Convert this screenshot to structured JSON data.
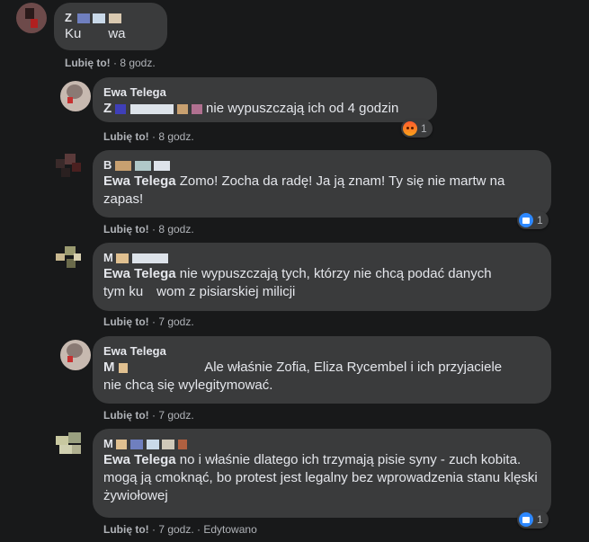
{
  "comments": [
    {
      "name": "Z",
      "text": "Ku  wa",
      "like": "Lubię to!",
      "time": "8 godz."
    },
    {
      "name": "Ewa Telega",
      "mention": "Z",
      "text": "nie wypuszczają ich od 4 godzin",
      "like": "Lubię to!",
      "time": "8 godz.",
      "reaction_count": "1",
      "reaction": "angry-icon"
    },
    {
      "name": "B",
      "mention": "Ewa Telega",
      "text": "Zomo! Zocha da radę! Ja ją znam! Ty się nie martw na zapas!",
      "like": "Lubię to!",
      "time": "8 godz.",
      "reaction_count": "1",
      "reaction": "like-icon"
    },
    {
      "name": "M",
      "mention": "Ewa Telega",
      "text_a": "nie wypuszczają tych, którzy nie chcą podać danych",
      "text_b": "tym ku wom z pisiarskiej milicji",
      "like": "Lubię to!",
      "time": "7 godz."
    },
    {
      "name": "Ewa Telega",
      "mention": "M",
      "text_a": "Ale właśnie Zofia, Eliza Rycembel i ich przyjaciele",
      "text_b": "nie chcą się wylegitymować.",
      "like": "Lubię to!",
      "time": "7 godz."
    },
    {
      "name": "M",
      "mention": "Ewa Telega",
      "text": "no i właśnie dlatego ich trzymają pisie syny - zuch kobita. mogą ją cmoknąć, bo protest jest legalny bez wprowadzenia stanu klęski żywiołowej",
      "like": "Lubię to!",
      "time": "7 godz.",
      "edited": "Edytowano",
      "reaction_count": "1",
      "reaction": "like-icon"
    }
  ],
  "sep": " · ",
  "colors": {
    "bg": "#18191a",
    "bubble": "#3a3b3c",
    "meta": "#b0b3b8",
    "like_blue": "#2d88ff"
  }
}
